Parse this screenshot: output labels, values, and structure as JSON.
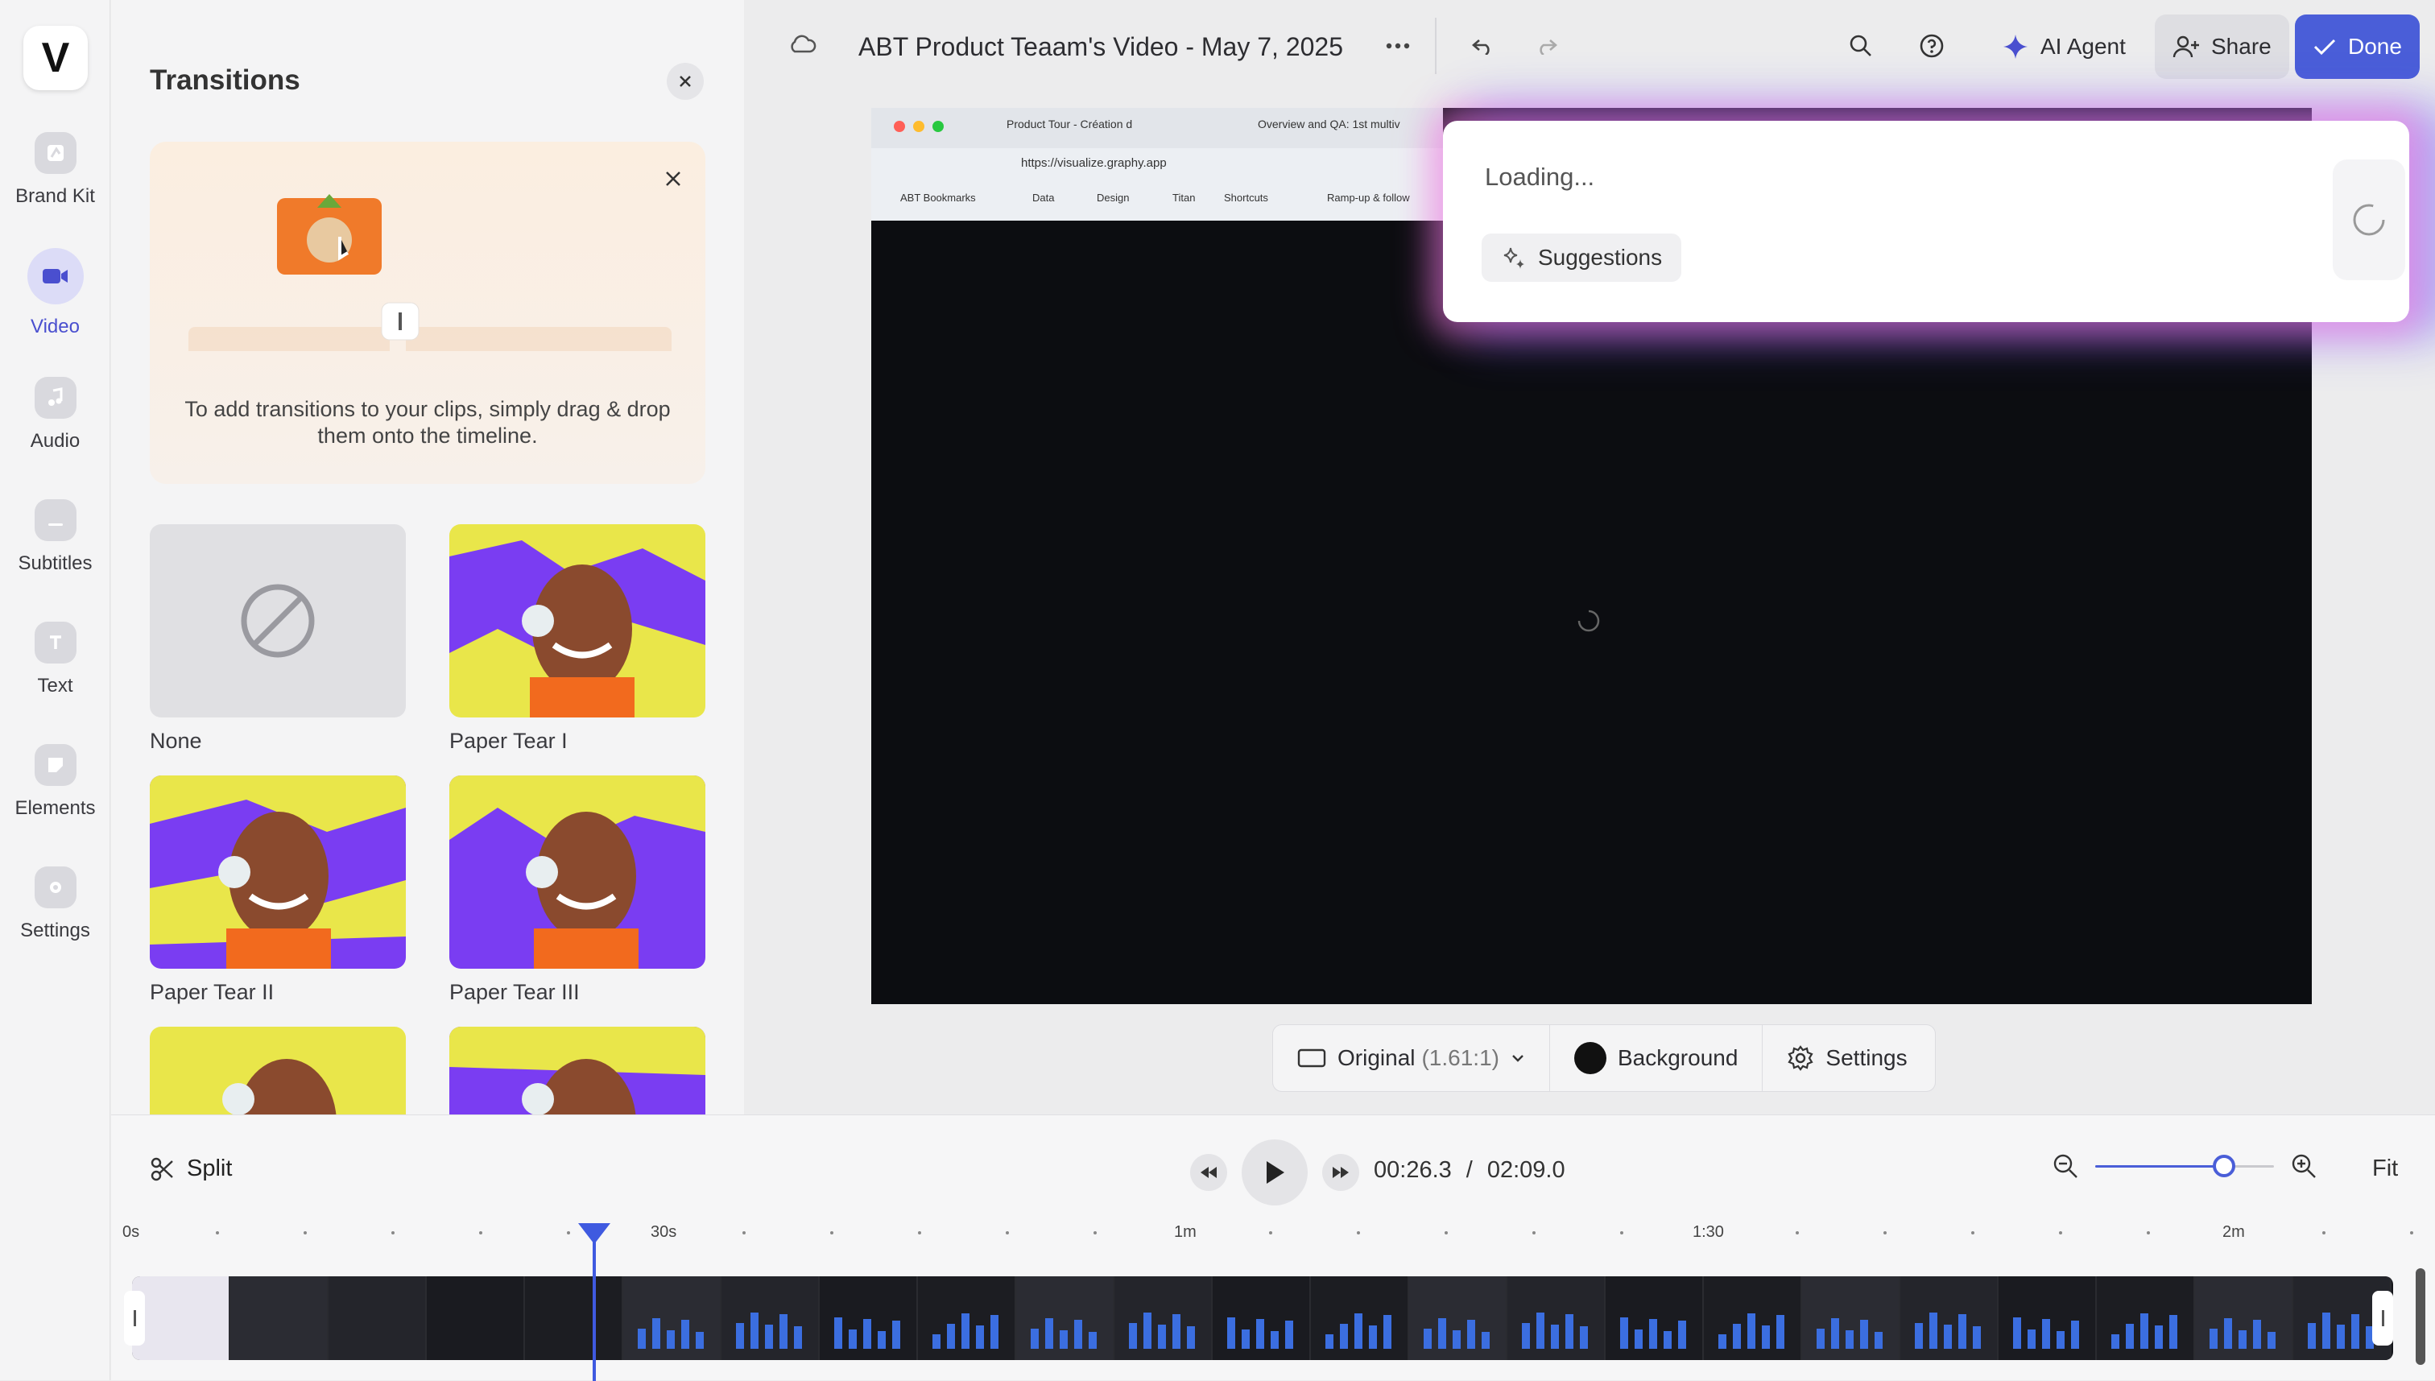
{
  "app": {
    "logo_letter": "V"
  },
  "rail": {
    "items": [
      {
        "label": "Brand Kit",
        "icon": "brand-kit-icon"
      },
      {
        "label": "Video",
        "icon": "video-camera-icon",
        "active": true
      },
      {
        "label": "Audio",
        "icon": "music-note-icon"
      },
      {
        "label": "Subtitles",
        "icon": "subtitles-icon"
      },
      {
        "label": "Text",
        "icon": "text-icon"
      },
      {
        "label": "Elements",
        "icon": "elements-icon"
      },
      {
        "label": "Settings",
        "icon": "settings-icon"
      }
    ]
  },
  "panel": {
    "title": "Transitions",
    "tip_text": "To add transitions to your clips, simply drag & drop them onto the timeline.",
    "transitions": [
      {
        "label": "None"
      },
      {
        "label": "Paper Tear I"
      },
      {
        "label": "Paper Tear II"
      },
      {
        "label": "Paper Tear III"
      }
    ]
  },
  "topbar": {
    "title": "ABT Product Teaam's Video - May 7, 2025",
    "ai_agent": "AI Agent",
    "share": "Share",
    "done": "Done"
  },
  "preview": {
    "tabs": [
      "Product Tour - Création d",
      "Overview and QA: 1st multiv"
    ],
    "url": "https://visualize.graphy.app",
    "bookmarks": [
      "ABT Bookmarks",
      "Data",
      "Design",
      "Titan",
      "Shortcuts",
      "Ramp-up & follow"
    ]
  },
  "ai_popup": {
    "loading": "Loading...",
    "suggestions": "Suggestions"
  },
  "canvas_bar": {
    "ratio_label": "Original",
    "ratio_value": "(1.61:1)",
    "background": "Background",
    "settings": "Settings"
  },
  "timeline": {
    "split": "Split",
    "current_time": "00:26.3",
    "separator": "/",
    "total_time": "02:09.0",
    "fit": "Fit",
    "zoom_level": 0.72,
    "playhead_time_s": 26.3,
    "ruler_labels": [
      "0s",
      "30s",
      "1m",
      "1:30",
      "2m"
    ]
  },
  "colors": {
    "accent": "#4a4fcf",
    "done_bg": "#4a5ed8",
    "playhead": "#3f5ae0"
  }
}
